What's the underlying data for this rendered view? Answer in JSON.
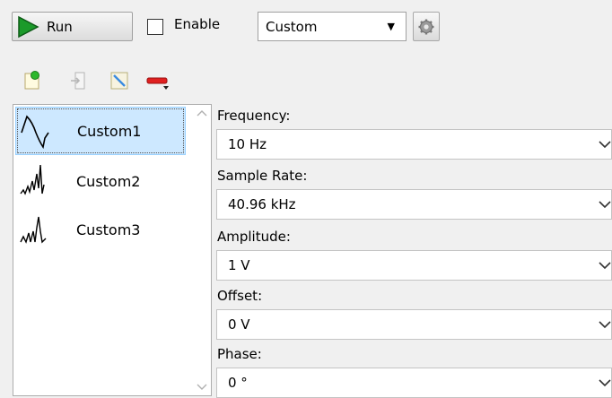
{
  "toolbar": {
    "run_label": "Run",
    "enable_label": "Enable",
    "mode_value": "Custom"
  },
  "tools": [
    "add-waveform-icon",
    "import-icon",
    "edit-icon",
    "remove-icon"
  ],
  "list": {
    "items": [
      {
        "label": "Custom1",
        "icon": "custom1-wave-icon",
        "selected": true
      },
      {
        "label": "Custom2",
        "icon": "custom2-wave-icon",
        "selected": false
      },
      {
        "label": "Custom3",
        "icon": "custom3-wave-icon",
        "selected": false
      }
    ]
  },
  "properties": {
    "frequency": {
      "label": "Frequency:",
      "value": "10 Hz"
    },
    "sample_rate": {
      "label": "Sample Rate:",
      "value": "40.96 kHz"
    },
    "amplitude": {
      "label": "Amplitude:",
      "value": "1 V"
    },
    "offset": {
      "label": "Offset:",
      "value": "0 V"
    },
    "phase": {
      "label": "Phase:",
      "value": "0 °"
    }
  },
  "colors": {
    "run_green": "#1b9a2a",
    "selection_bg": "#cde8ff",
    "selection_border": "#99d1ff"
  }
}
